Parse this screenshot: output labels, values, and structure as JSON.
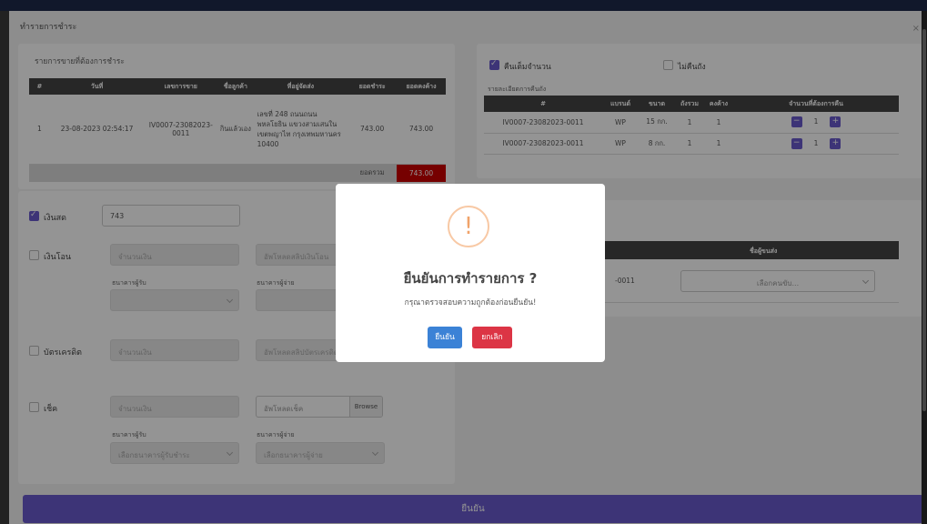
{
  "page": {
    "title": "ทำรายการชำระ",
    "close": "×"
  },
  "sale_table": {
    "title": "รายการขายที่ต้องการชำระ",
    "headers": [
      "#",
      "วันที่",
      "เลขการขาย",
      "ชื่อลูกค้า",
      "ที่อยู่จัดส่ง",
      "ยอดชำระ",
      "ยอดคงค้าง"
    ],
    "rows": [
      {
        "no": "1",
        "date": "23-08-2023 02:54:17",
        "sale_no": "IV0007-23082023-0011",
        "customer": "กินแล้วเอง",
        "address": "เลขที่ 248 ถนนถนนพหลโยธิน แขวงสามเสนใน เขตพญาไท กรุงเทพมหานคร 10400",
        "paid": "743.00",
        "outstanding": "743.00"
      }
    ],
    "total_label": "ยอดรวม",
    "total_value": "743.00"
  },
  "return_panel": {
    "full_return_label": "คืนเต็มจำนวน",
    "no_return_label": "ไม่คืนถัง",
    "detail_title": "รายละเอียดการคืนถัง",
    "headers": [
      "#",
      "แบรนด์",
      "ขนาด",
      "ถังรวม",
      "คงค้าง",
      "จำนวนที่ต้องการคืน"
    ],
    "rows": [
      {
        "no": "IV0007-23082023-0011",
        "brand": "WP",
        "size": "15 กก.",
        "total": "1",
        "remain": "1",
        "qty": "1"
      },
      {
        "no": "IV0007-23082023-0011",
        "brand": "WP",
        "size": "8 กก.",
        "total": "1",
        "remain": "1",
        "qty": "1"
      }
    ],
    "minus": "−",
    "plus": "+"
  },
  "payment": {
    "cash": {
      "label": "เงินสด",
      "value": "743"
    },
    "transfer": {
      "label": "เงินโอน",
      "amount_placeholder": "จำนวนเงิน",
      "upload_placeholder": "อัพโหลดสลิปเงินโอน",
      "receiver_bank_label": "ธนาคารผู้รับ",
      "payer_bank_label": "ธนาคารผู้จ่าย"
    },
    "credit": {
      "label": "บัตรเครดิต",
      "amount_placeholder": "จำนวนเงิน",
      "upload_placeholder": "อัพโหลดสลิปบัตรเครดิต"
    },
    "cheque": {
      "label": "เช็ค",
      "amount_placeholder": "จำนวนเงิน",
      "upload_placeholder": "อัพโหลดเช็ค",
      "browse": "Browse",
      "receiver_bank_label": "ธนาคารผู้รับ",
      "payer_bank_label": "ธนาคารผู้จ่าย",
      "receiver_select": "เลือกธนาคารผู้รับชำระ",
      "payer_select": "เลือกธนาคารผู้จ่าย"
    }
  },
  "delivery": {
    "header": "ชื่อผู้ขนส่ง",
    "row_no": "-0011",
    "select": "เลือกคนขับ..."
  },
  "submit_label": "ยืนยัน",
  "modal": {
    "icon": "!",
    "title": "ยืนยันการทำรายการ ?",
    "text": "กรุณาตรวจสอบความถูกต้องก่อนยืนยัน!",
    "confirm": "ยืนยัน",
    "cancel": "ยกเลิก"
  },
  "colors": {
    "accent": "#6a5acd",
    "confirm": "#3b82d6",
    "cancel": "#dc3545",
    "total_bg": "#cc0000"
  }
}
